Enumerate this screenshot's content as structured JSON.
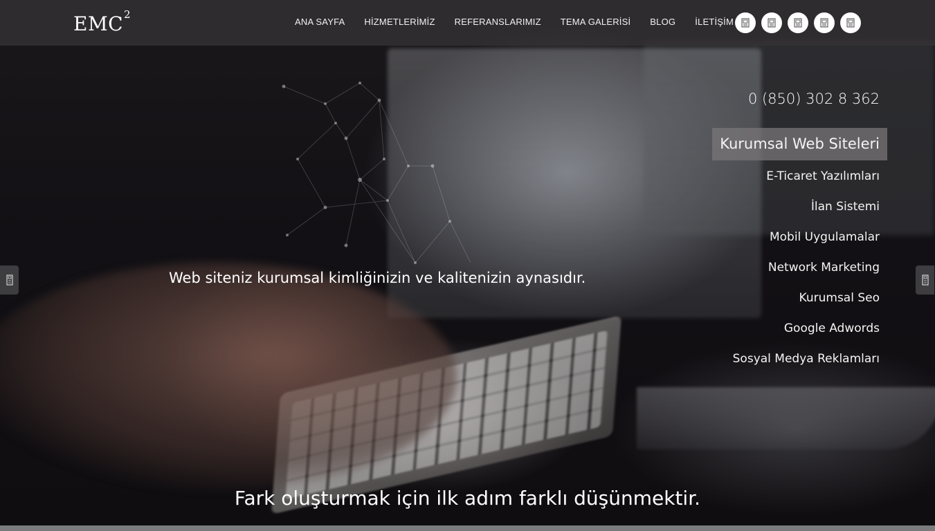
{
  "header": {
    "logo_text": "EMC",
    "logo_sup": "2",
    "nav": [
      {
        "label": "ANA SAYFA"
      },
      {
        "label": "HİZMETLERİMİZ"
      },
      {
        "label": "REFERANSLARIMIZ"
      },
      {
        "label": "TEMA GALERİSİ"
      },
      {
        "label": "BLOG"
      },
      {
        "label": "İLETİŞİM"
      }
    ],
    "social_icons": [
      "social-icon-1",
      "social-icon-2",
      "social-icon-3",
      "social-icon-4",
      "social-icon-5"
    ]
  },
  "hero": {
    "phone": "0 (850) 302 8 362",
    "services": [
      {
        "label": "Kurumsal Web Siteleri",
        "active": true
      },
      {
        "label": "E-Ticaret Yazılımları"
      },
      {
        "label": "İlan Sistemi"
      },
      {
        "label": "Mobil Uygulamalar"
      },
      {
        "label": "Network Marketing"
      },
      {
        "label": "Kurumsal Seo"
      },
      {
        "label": "Google Adwords"
      },
      {
        "label": "Sosyal Medya Reklamları"
      }
    ],
    "tagline": "Web siteniz kurumsal kimliğinizin ve kalitenizin aynasıdır.",
    "motto": "Fark oluşturmak için ilk adım farklı düşünmektir."
  },
  "colors": {
    "topbar": "#373437",
    "active_service_bg": "#787678",
    "text": "#ffffff"
  }
}
